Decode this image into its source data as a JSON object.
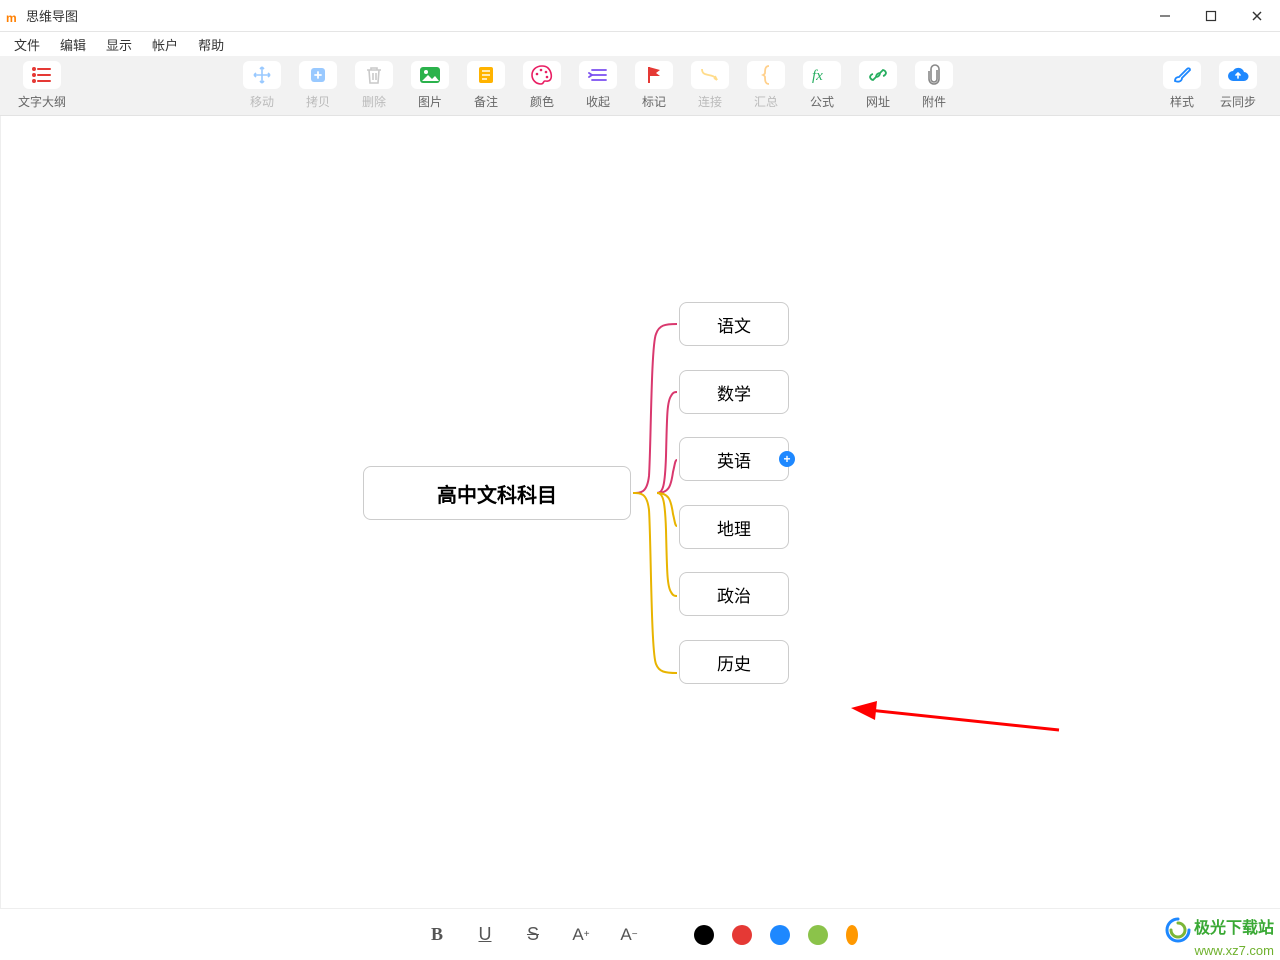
{
  "window": {
    "title": "思维导图"
  },
  "menu": {
    "items": [
      "文件",
      "编辑",
      "显示",
      "帐户",
      "帮助"
    ]
  },
  "toolbar": {
    "outline": "文字大纲",
    "move": "移动",
    "copy": "拷贝",
    "delete": "删除",
    "image": "图片",
    "note": "备注",
    "color": "颜色",
    "collapse": "收起",
    "mark": "标记",
    "connect": "连接",
    "summary": "汇总",
    "formula": "公式",
    "url": "网址",
    "attach": "附件",
    "style": "样式",
    "sync": "云同步"
  },
  "mindmap": {
    "root": "高中文科科目",
    "children": [
      "语文",
      "数学",
      "英语",
      "地理",
      "政治",
      "历史"
    ],
    "branch_colors": {
      "top": "#d9386e",
      "bottom": "#e8b400"
    }
  },
  "formatbar": {
    "bold": "B",
    "underline": "U",
    "strike": "S",
    "fontInc": "A+",
    "fontDec": "A-",
    "colors": [
      "#000000",
      "#e53935",
      "#1e88ff",
      "#8bc34a",
      "#ff9800"
    ]
  },
  "watermark": {
    "brand": "极光下载站",
    "url": "www.xz7.com"
  }
}
